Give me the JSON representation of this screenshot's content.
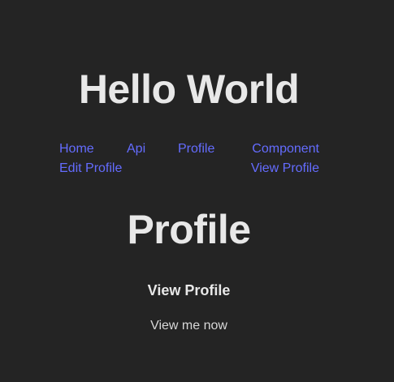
{
  "app": {
    "title": "Hello World"
  },
  "nav": {
    "links": [
      {
        "label": "Home"
      },
      {
        "label": "Api"
      },
      {
        "label": "Profile"
      },
      {
        "label": "Component"
      },
      {
        "label": "Edit Profile"
      },
      {
        "label": "View Profile"
      }
    ]
  },
  "page": {
    "heading": "Profile",
    "section_heading": "View Profile",
    "section_text": "View me now"
  },
  "colors": {
    "background": "#242424",
    "link": "#646cff",
    "text": "#e8e8e8"
  }
}
